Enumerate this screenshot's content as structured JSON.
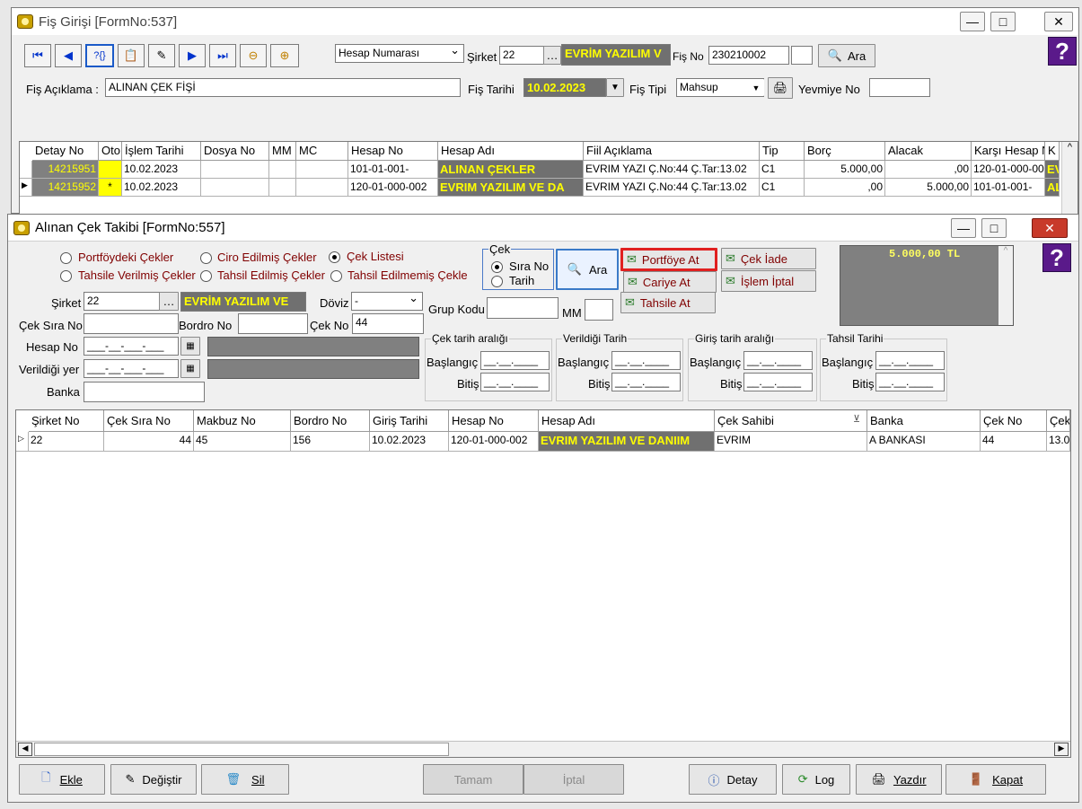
{
  "fis_window": {
    "title": "Fiş Girişi [FormNo:537]",
    "hesap_select": "Hesap Numarası",
    "sirket_label": "Şirket",
    "sirket_value": "22",
    "sirket_name": "EVRİM YAZILIM  V",
    "fis_no_label": "Fiş No",
    "fis_no_value": "230210002",
    "ara_label": "Ara",
    "fis_aciklama_label": "Fiş Açıklama :",
    "fis_aciklama_value": "ALINAN ÇEK FİŞİ",
    "fis_tarihi_label": "Fiş Tarihi",
    "fis_tarihi_value": "10.02.2023",
    "fis_tipi_label": "Fiş  Tipi",
    "fis_tipi_value": "Mahsup",
    "yevmiye_label": "Yevmiye No",
    "columns": [
      "Detay No",
      "Oto",
      "İşlem Tarihi",
      "Dosya No",
      "MM",
      "MC",
      "Hesap No",
      "Hesap Adı",
      "Fiil Açıklama",
      "Tip",
      "Borç",
      "Alacak",
      "Karşı Hesap N",
      "K"
    ],
    "rows": [
      {
        "detay": "14215951",
        "oto": "",
        "tarih": "10.02.2023",
        "dosya": "",
        "mm": "",
        "mc": "",
        "hesap": "101-01-001-",
        "hesap_adi": "ALINAN ÇEKLER",
        "aciklama": "EVRIM YAZI Ç.No:44 Ç.Tar:13.02",
        "tip": "C1",
        "borc": "5.000,00",
        "alacak": ",00",
        "karsi": "120-01-000-00",
        "k": "EV"
      },
      {
        "detay": "14215952",
        "oto": "*",
        "tarih": "10.02.2023",
        "dosya": "",
        "mm": "",
        "mc": "",
        "hesap": "120-01-000-002",
        "hesap_adi": "EVRIM YAZILIM VE DA",
        "aciklama": "EVRIM YAZI Ç.No:44 Ç.Tar:13.02",
        "tip": "C1",
        "borc": ",00",
        "alacak": "5.000,00",
        "karsi": "101-01-001-",
        "k": "AL"
      }
    ]
  },
  "cek_window": {
    "title": "Alınan Çek Takibi [FormNo:557]",
    "radios": [
      {
        "label": "Portföydeki Çekler",
        "on": false
      },
      {
        "label": "Ciro Edilmiş Çekler",
        "on": false
      },
      {
        "label": "Çek Listesi",
        "on": true
      },
      {
        "label": "Tahsile Verilmiş Çekler",
        "on": false
      },
      {
        "label": "Tahsil Edilmiş Çekler",
        "on": false
      },
      {
        "label": "Tahsil Edilmemiş Çekle",
        "on": false
      }
    ],
    "cek_group_label": "Çek",
    "sira_no_label": "Sıra No",
    "tarih_label": "Tarih",
    "ara_label": "Ara",
    "portfoye_at": "Portföye At",
    "cek_iade": "Çek İade",
    "cariye_at": "Cariye At",
    "islem_iptal": "İşlem İptal",
    "tahsile_at": "Tahsile At",
    "total": "5.000,00 TL",
    "sirket_label": "Şirket",
    "sirket_value": "22",
    "sirket_name": "EVRİM YAZILIM  VE",
    "doviz_label": "Döviz",
    "doviz_value": "-",
    "grup_kodu_label": "Grup Kodu",
    "mm_label": "MM",
    "cek_sira_label": "Çek Sıra No",
    "bordro_label": "Bordro No",
    "cek_no_label": "Çek No",
    "cek_no_value": "44",
    "hesap_no_label": "Hesap No",
    "verildigi_label": "Verildiği yer",
    "banka_label": "Banka",
    "mask": "___-__-___-___",
    "date_groups": [
      "Çek tarih aralığı",
      "Verildiği Tarih",
      "Giriş tarih aralığı",
      "Tahsil Tarihi"
    ],
    "baslangic": "Başlangıç",
    "bitis": "Bitiş",
    "date_mask": "__.__.____",
    "columns": [
      "Şirket No",
      "Çek Sıra No",
      "Makbuz No",
      "Bordro No",
      "Giriş Tarihi",
      "Hesap No",
      "Hesap Adı",
      "Çek Sahibi",
      "Banka",
      "Çek No",
      "Çek"
    ],
    "row": {
      "sirket": "22",
      "sira": "44",
      "makbuz": "45",
      "bordro": "156",
      "giris": "10.02.2023",
      "hesap": "120-01-000-002",
      "hesap_adi": "EVRIM YAZILIM VE DANIIM",
      "sahibi": "EVRIM",
      "banka": "A BANKASI",
      "cek_no": "44",
      "cek": "13.0"
    },
    "bottom": {
      "ekle": "Ekle",
      "degistir": "Değiştir",
      "sil": "Sil",
      "tamam": "Tamam",
      "iptal": "İptal",
      "detay": "Detay",
      "log": "Log",
      "yazdir": "Yazdır",
      "kapat": "Kapat"
    }
  }
}
